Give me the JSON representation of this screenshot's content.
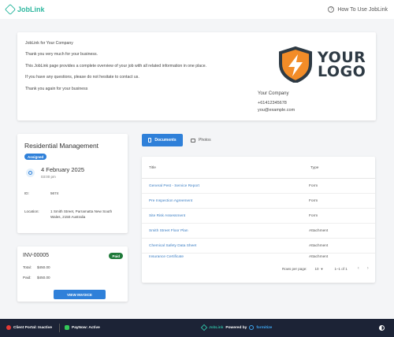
{
  "header": {
    "brand": "JobLink",
    "help_link": "How To Use JobLink"
  },
  "letter": {
    "lines": [
      "JobLink for Your Company",
      "Thank you very much for your business.",
      "This JobLink page provides a complete overview of your job with all related information in one place.",
      "If you have any questions, please do not hesitate to contact us.",
      "Thank you again for your business"
    ],
    "logo_word_1": "YOUR",
    "logo_word_2": "LOGO",
    "company_name": "Your Company",
    "phone": "+61412345678",
    "email": "you@example.com"
  },
  "job": {
    "title": "Residential Management",
    "status": "Assigned",
    "date": "4 February 2025",
    "time": "03:00 pm",
    "id_label": "ID:",
    "id_value": "5674",
    "location_label": "Location:",
    "location_value": "1 Smith Street, Parramatta New South Wales, 2150 Australia"
  },
  "invoice": {
    "number": "INV-00005",
    "status": "Paid",
    "total_label": "Total:",
    "total_value": "$450.00",
    "paid_label": "Paid:",
    "paid_value": "$450.00",
    "view_button": "VIEW INVOICE"
  },
  "tabs": {
    "documents": "Documents",
    "photos": "Photos"
  },
  "documents": {
    "columns": [
      "Title",
      "Type"
    ],
    "rows": [
      {
        "title": "General Pest - Service Report",
        "type": "Form"
      },
      {
        "title": "Pre Inspection Agreement",
        "type": "Form"
      },
      {
        "title": "Site Risk Assessment",
        "type": "Form"
      },
      {
        "title": "Smith Street Floor Plan",
        "type": "Attachment"
      },
      {
        "title": "Chemical Safety Data Sheet",
        "type": "Attachment"
      },
      {
        "title": "Insurance Certificate",
        "type": "Attachment"
      }
    ],
    "rows_per_page_label": "Rows per page:",
    "rows_per_page_value": "10",
    "range": "1–1 of 1"
  },
  "footer": {
    "client_portal": "Client Portal: Inactive",
    "paynow": "PayNow: Active",
    "brand": "JobLink",
    "powered_by": "Powered by",
    "partner": "formitize"
  },
  "colors": {
    "accent": "#2f80d9",
    "brand": "#2fb8a0",
    "logo_orange": "#f28c28",
    "logo_dark": "#2e3a44",
    "footer_bg": "#1c2336",
    "paid_green": "#1f7a3a"
  }
}
